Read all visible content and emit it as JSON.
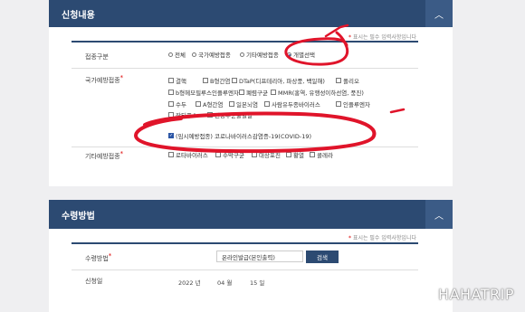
{
  "section1": {
    "title": "신청내용",
    "required_note": "표시는 필수 입력사항입니다",
    "vaccination_type": {
      "label": "접종구분",
      "options": [
        "전체",
        "국가예방접종",
        "기타예방접종",
        "개별선택"
      ],
      "selected": "개별선택"
    },
    "national_vaccines": {
      "label": "국가예방접종",
      "options": [
        "결핵",
        "B형간염",
        "DTaP(디프테리아, 파상풍, 백일해)",
        "폴리오",
        "b형헤모필루스인플루엔자",
        "폐렴구균",
        "MMR(홍역, 유행성이하선염, 풍진)",
        "수두",
        "A형간염",
        "일본뇌염",
        "사람유두종바이러스",
        "인플루엔자",
        "장티푸스",
        "신증후군출혈열"
      ],
      "covid_option": "(임시예방접종) 코로나바이러스감염증-19(COVID-19)"
    },
    "other_vaccines": {
      "label": "기타예방접종",
      "options": [
        "로타바이러스",
        "수막구균",
        "대상포진",
        "황열",
        "콜레라"
      ]
    }
  },
  "section2": {
    "title": "수령방법",
    "required_note": "표시는 필수 입력사항입니다",
    "receive_method": {
      "label": "수령방법",
      "value": "온라인발급(본인출력)",
      "button": "검색"
    },
    "apply_date": {
      "label": "신청일",
      "year": "2022",
      "year_unit": "년",
      "month": "04",
      "month_unit": "월",
      "day": "15",
      "day_unit": "일"
    }
  },
  "watermark": "HAHATRIP",
  "colors": {
    "header": "#2c4a72",
    "annotation": "#e0142a"
  }
}
